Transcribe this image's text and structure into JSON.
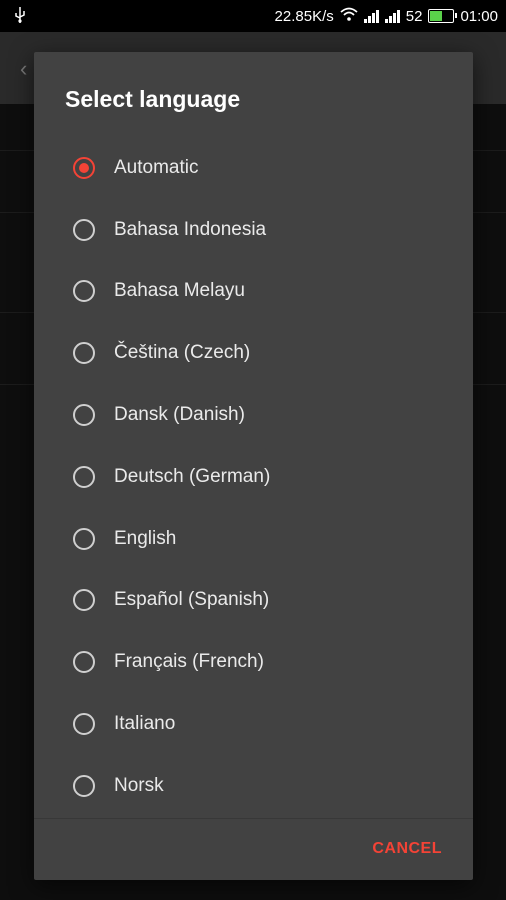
{
  "status_bar": {
    "net_speed": "22.85K/s",
    "battery_level": "52",
    "time": "01:00"
  },
  "dialog": {
    "title": "Select language",
    "selected_index": 0,
    "options": [
      {
        "label": "Automatic"
      },
      {
        "label": "Bahasa Indonesia"
      },
      {
        "label": "Bahasa Melayu"
      },
      {
        "label": "Čeština (Czech)"
      },
      {
        "label": "Dansk (Danish)"
      },
      {
        "label": "Deutsch (German)"
      },
      {
        "label": "English"
      },
      {
        "label": "Español (Spanish)"
      },
      {
        "label": "Français (French)"
      },
      {
        "label": "Italiano"
      },
      {
        "label": "Norsk"
      }
    ],
    "cancel_label": "CANCEL"
  },
  "colors": {
    "accent": "#f44336",
    "dialog_bg": "#424242",
    "battery_fill": "#5ad14a"
  }
}
